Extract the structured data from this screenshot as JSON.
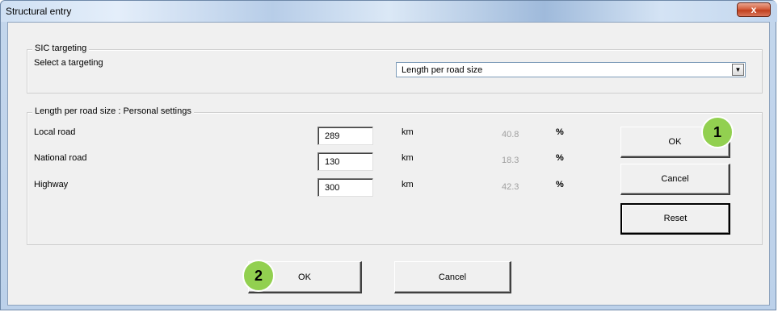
{
  "window": {
    "title": "Structural entry",
    "close_label": "x"
  },
  "targeting": {
    "legend": "SIC targeting",
    "label": "Select a targeting",
    "selected": "Length per road size",
    "dropdown_icon": "chevron-down-icon"
  },
  "settings": {
    "legend": "Length per road size : Personal settings",
    "rows": [
      {
        "label": "Local road",
        "value": "289",
        "unit": "km",
        "percent": "40.8",
        "pct_sign": "%"
      },
      {
        "label": "National road",
        "value": "130",
        "unit": "km",
        "percent": "18.3",
        "pct_sign": "%"
      },
      {
        "label": "Highway",
        "value": "300",
        "unit": "km",
        "percent": "42.3",
        "pct_sign": "%"
      }
    ],
    "ok_label": "OK",
    "cancel_label": "Cancel",
    "reset_label": "Reset"
  },
  "footer": {
    "ok_label": "OK",
    "cancel_label": "Cancel"
  },
  "callouts": {
    "one": "1",
    "two": "2",
    "color": "#92d050"
  }
}
